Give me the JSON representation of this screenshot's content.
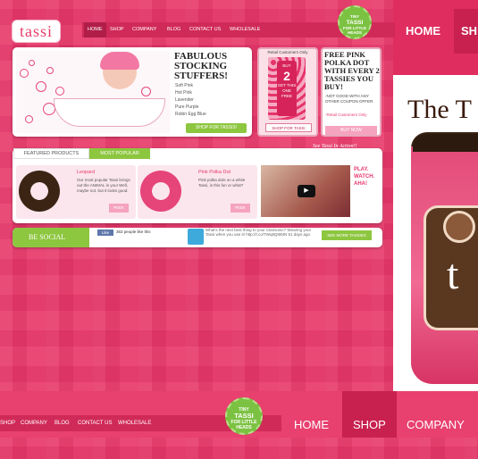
{
  "logo": {
    "text": "tassi"
  },
  "nav": {
    "home": "HOME",
    "shop": "SHOP",
    "company": "COMPANY",
    "blog": "BLOG",
    "contact": "CONTACT US",
    "wholesale": "WHOLESALE"
  },
  "badge": {
    "line1": "TINY",
    "line2": "TASSI",
    "line3": "FOR LITTLE",
    "line4": "HEADS"
  },
  "hero": {
    "title": "FABULOUS STOCKING STUFFERS!",
    "items": [
      "Soft Pink",
      "Hot Pink",
      "Lavender",
      "Pure Purple",
      "Robin Egg Blue"
    ],
    "button": "SHOP FOR TASSIS!"
  },
  "promo1": {
    "label": "Retail Customers Only",
    "card_line1": "BUY",
    "card_num": "2",
    "card_line2": "GET THIS ONE FREE",
    "button": "SHOP FOR TASSI"
  },
  "promo2": {
    "title": "FREE PINK POLKA DOT WITH EVERY 2 TASSIES YOU BUY!",
    "sub": "-NOT GOOD WITH ANY OTHER COUPON OFFER.",
    "note": "-Retail Customers Only",
    "button": "BUY NOW"
  },
  "features": {
    "tab1": "FEATURED PRODUCTS",
    "tab2": "MOST POPULAR",
    "annotation": "See Tassi In Action!!"
  },
  "products": [
    {
      "title": "Leopard",
      "desc": "Our most popular Tassi brings out the ANIMAL in you! Well, maybe not, but it looks good.",
      "button": "PEEK"
    },
    {
      "title": "Pink Polka Dot",
      "desc": "Pink polka dots on a white Tassi, is this fun or what?",
      "button": "PEEK"
    }
  ],
  "video": {
    "play": "▶",
    "caption": "PLAY. WATCH. AHA!"
  },
  "social": {
    "label": "BE SOCIAL",
    "like": "Like",
    "likes": "363 people like this",
    "tweet": "What's the next best thing to your Clarisonic? Wearing your Tassi when you use it! http://t.co/TWq8QtIIMN 51 days ago",
    "button": "SEE MORE TASSIES"
  },
  "right": {
    "home": "HOME",
    "shop": "SH",
    "headline": "The T",
    "jar_letter": "t"
  },
  "bottom": {
    "shop": "SHOP",
    "company": "COMPANY",
    "blog": "BLOG",
    "contact": "CONTACT US",
    "wholesale": "WHOLESALE",
    "home": "HOME",
    "shop_big": "SHOP",
    "company_big": "COMPANY"
  },
  "colors": {
    "pink": "#e83a6b",
    "green": "#8dc63f",
    "white": "#ffffff"
  }
}
